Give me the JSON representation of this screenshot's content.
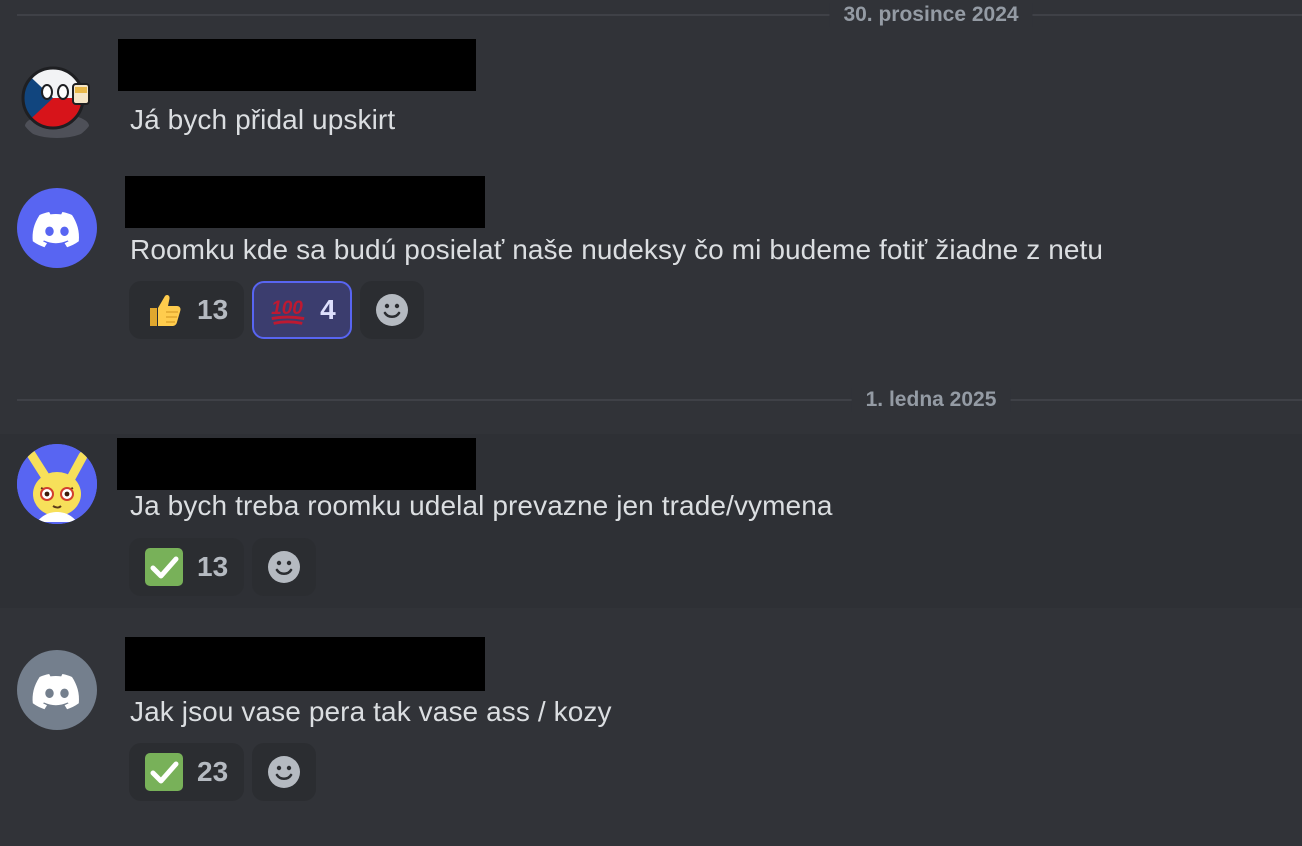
{
  "dividers": [
    {
      "label": "30. prosince 2024"
    },
    {
      "label": "1. ledna 2025"
    }
  ],
  "messages": [
    {
      "avatar": "countryball-czech-avatar",
      "text": "Já bych přidal upskirt",
      "reactions": []
    },
    {
      "avatar": "discord-default-avatar",
      "avatar_color": "#5865f2",
      "text": "Roomku kde sa budú posielať naše nudeksy čo mi budeme fotiť žiadne z netu",
      "reactions": [
        {
          "emoji": "thumbs-up-icon",
          "count": "13",
          "selected": false
        },
        {
          "emoji": "hundred-points-icon",
          "count": "4",
          "selected": true
        }
      ]
    },
    {
      "avatar": "anime-character-avatar",
      "avatar_color": "#5865f2",
      "text": "Ja bych treba roomku udelal prevazne jen trade/vymena",
      "reactions": [
        {
          "emoji": "check-mark-button-icon",
          "count": "13",
          "selected": false
        }
      ]
    },
    {
      "avatar": "discord-default-avatar",
      "avatar_color": "#747f8d",
      "text": "Jak jsou vase pera tak vase ass / kozy",
      "reactions": [
        {
          "emoji": "check-mark-button-icon",
          "count": "23",
          "selected": false
        }
      ]
    }
  ],
  "colors": {
    "background": "#313338",
    "blurple": "#5865f2",
    "check_green": "#78b159",
    "hundred_red": "#be1931"
  }
}
